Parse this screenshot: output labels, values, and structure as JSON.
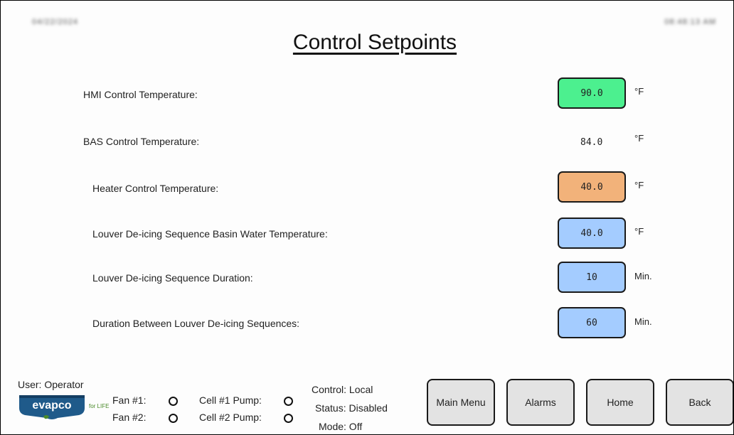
{
  "header": {
    "date": "04/22/2024",
    "time": "08:48:13 AM",
    "title": "Control Setpoints"
  },
  "setpoints": [
    {
      "label": "HMI Control Temperature:",
      "value": "90.0",
      "unit": "°F",
      "color": "#4cf08f"
    },
    {
      "label": "BAS Control Temperature:",
      "value": "84.0",
      "unit": "°F",
      "color": ""
    },
    {
      "label": "Heater Control Temperature:",
      "value": "40.0",
      "unit": "°F",
      "color": "#f2b27a"
    },
    {
      "label": "Louver De-icing Sequence Basin Water Temperature:",
      "value": "40.0",
      "unit": "°F",
      "color": "#a4ccff"
    },
    {
      "label": "Louver De-icing Sequence Duration:",
      "value": "10",
      "unit": "Min.",
      "color": "#a4ccff"
    },
    {
      "label": "Duration Between Louver De-icing Sequences:",
      "value": "60",
      "unit": "Min.",
      "color": "#a4ccff"
    }
  ],
  "footer": {
    "user": "User: Operator",
    "logo_text": "evapco",
    "logo_tag": "for LIFE",
    "fan1": "Fan #1:",
    "fan2": "Fan #2:",
    "pump1": "Cell #1 Pump:",
    "pump2": "Cell #2 Pump:",
    "control": "Control: Local",
    "status": "Status: Disabled",
    "mode": "Mode: Off"
  },
  "nav": {
    "main_menu": "Main Menu",
    "alarms": "Alarms",
    "home": "Home",
    "back": "Back"
  }
}
